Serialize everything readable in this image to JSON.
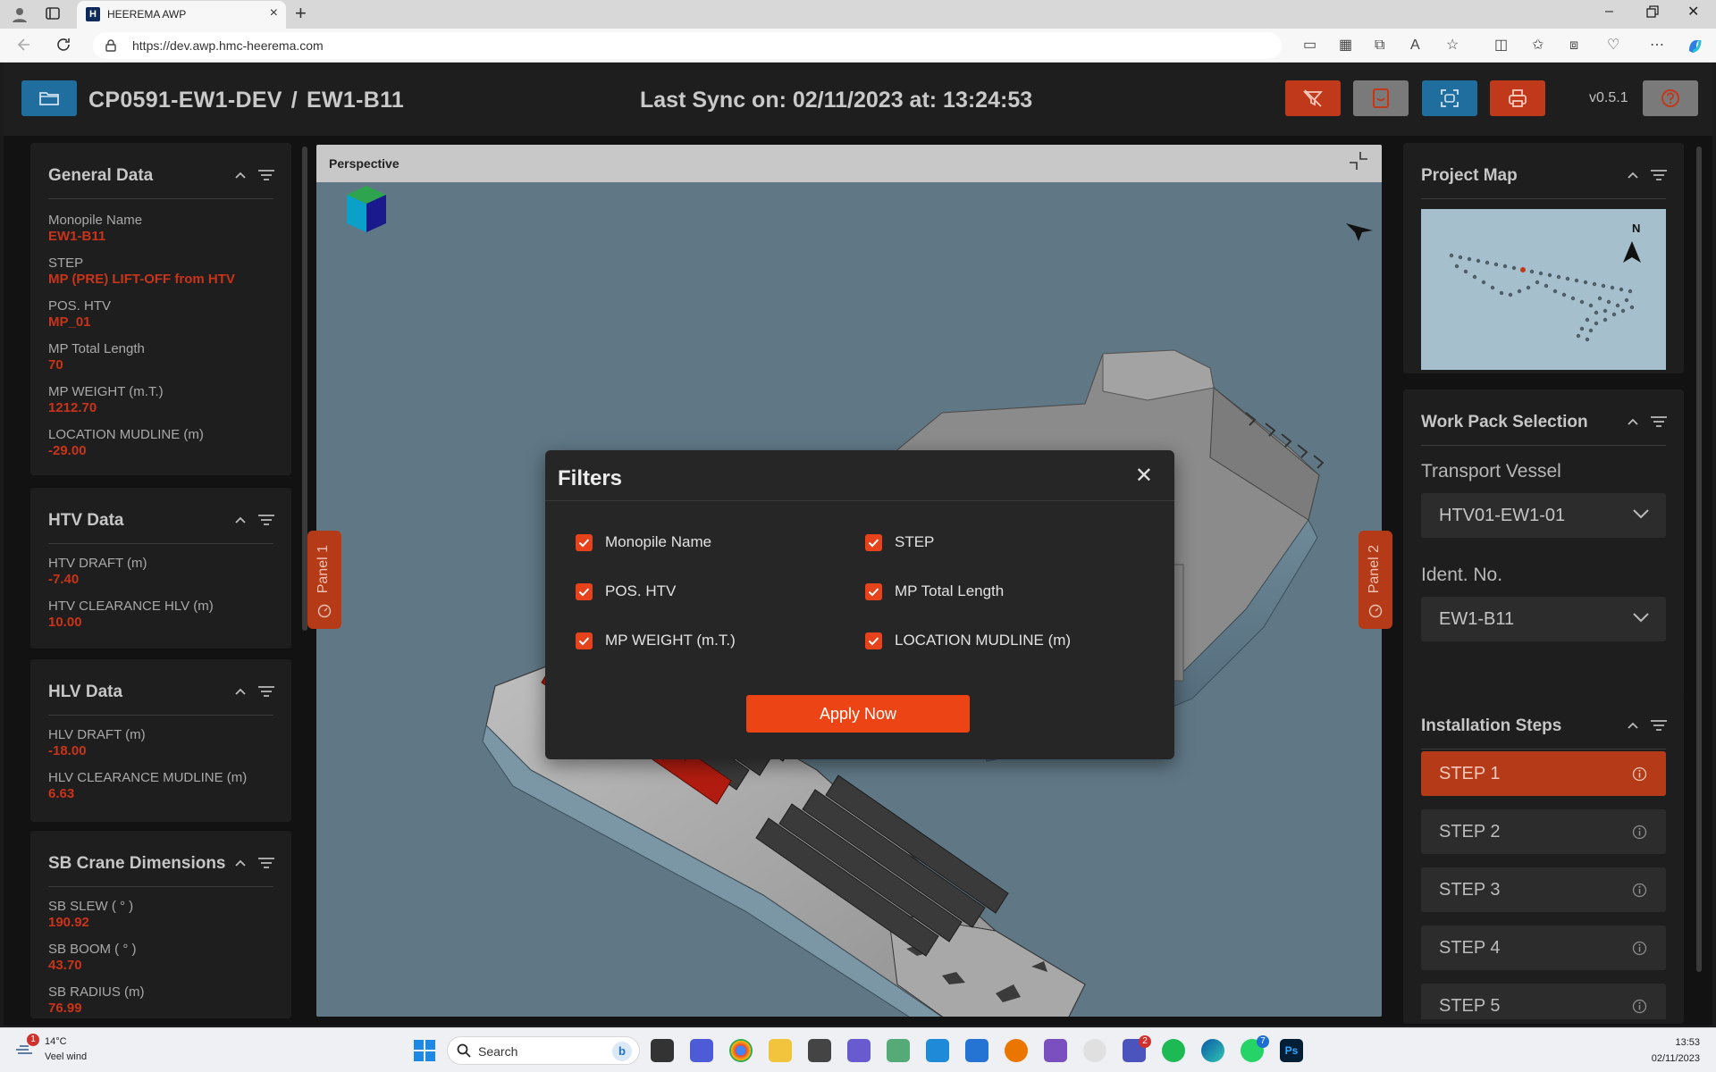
{
  "browser": {
    "tab_title": "HEEREMA AWP",
    "tab_favicon_letter": "H",
    "url": "https://dev.awp.hmc-heerema.com"
  },
  "header": {
    "project": "CP0591-EW1-DEV",
    "separator": "/",
    "location": "EW1-B11",
    "sync": "Last Sync on: 02/11/2023 at: 13:24:53",
    "version": "v0.5.1",
    "colors": {
      "accent_red": "#c0391b",
      "gray_button": "#7a7a7a",
      "blue_button": "#1f6e9e"
    }
  },
  "left_panel": {
    "general": {
      "title": "General Data",
      "fields": [
        {
          "label": "Monopile Name",
          "value": "EW1-B11"
        },
        {
          "label": "STEP",
          "value": "MP (PRE) LIFT-OFF from HTV"
        },
        {
          "label": "POS. HTV",
          "value": "MP_01"
        },
        {
          "label": "MP Total Length",
          "value": "70"
        },
        {
          "label": "MP WEIGHT (m.T.)",
          "value": "1212.70"
        },
        {
          "label": "LOCATION MUDLINE (m)",
          "value": "-29.00"
        }
      ]
    },
    "htv": {
      "title": "HTV Data",
      "fields": [
        {
          "label": "HTV DRAFT (m)",
          "value": "-7.40"
        },
        {
          "label": "HTV CLEARANCE HLV (m)",
          "value": "10.00"
        }
      ]
    },
    "hlv": {
      "title": "HLV Data",
      "fields": [
        {
          "label": "HLV DRAFT (m)",
          "value": "-18.00"
        },
        {
          "label": "HLV CLEARANCE MUDLINE (m)",
          "value": "6.63"
        }
      ]
    },
    "crane": {
      "title": "SB Crane Dimensions",
      "fields": [
        {
          "label": "SB SLEW ( ° )",
          "value": "190.92"
        },
        {
          "label": "SB BOOM ( ° )",
          "value": "43.70"
        },
        {
          "label": "SB RADIUS (m)",
          "value": "76.99"
        }
      ]
    }
  },
  "viewport": {
    "title": "Perspective",
    "panel1": "Panel 1",
    "panel2": "Panel 2",
    "north": "N"
  },
  "dialog": {
    "title": "Filters",
    "options": [
      {
        "label": "Monopile Name",
        "checked": true
      },
      {
        "label": "STEP",
        "checked": true
      },
      {
        "label": "POS. HTV",
        "checked": true
      },
      {
        "label": "MP Total Length",
        "checked": true
      },
      {
        "label": "MP WEIGHT (m.T.)",
        "checked": true
      },
      {
        "label": "LOCATION MUDLINE (m)",
        "checked": true
      }
    ],
    "apply_label": "Apply Now"
  },
  "right_panel": {
    "map": {
      "title": "Project Map",
      "north": "N"
    },
    "work_pack": {
      "title": "Work Pack Selection",
      "vessel_label": "Transport Vessel",
      "vessel_value": "HTV01-EW1-01",
      "ident_label": "Ident. No.",
      "ident_value": "EW1-B11"
    },
    "steps": {
      "title": "Installation Steps",
      "items": [
        {
          "label": "STEP 1",
          "active": true
        },
        {
          "label": "STEP 2",
          "active": false
        },
        {
          "label": "STEP 3",
          "active": false
        },
        {
          "label": "STEP 4",
          "active": false
        },
        {
          "label": "STEP 5",
          "active": false
        }
      ]
    }
  },
  "taskbar": {
    "temperature": "14°C",
    "weather": "Veel wind",
    "weather_badge": "1",
    "search_placeholder": "Search",
    "time": "13:53",
    "date": "02/11/2023",
    "teams_badge": "2",
    "whatsapp_badge": "7"
  }
}
